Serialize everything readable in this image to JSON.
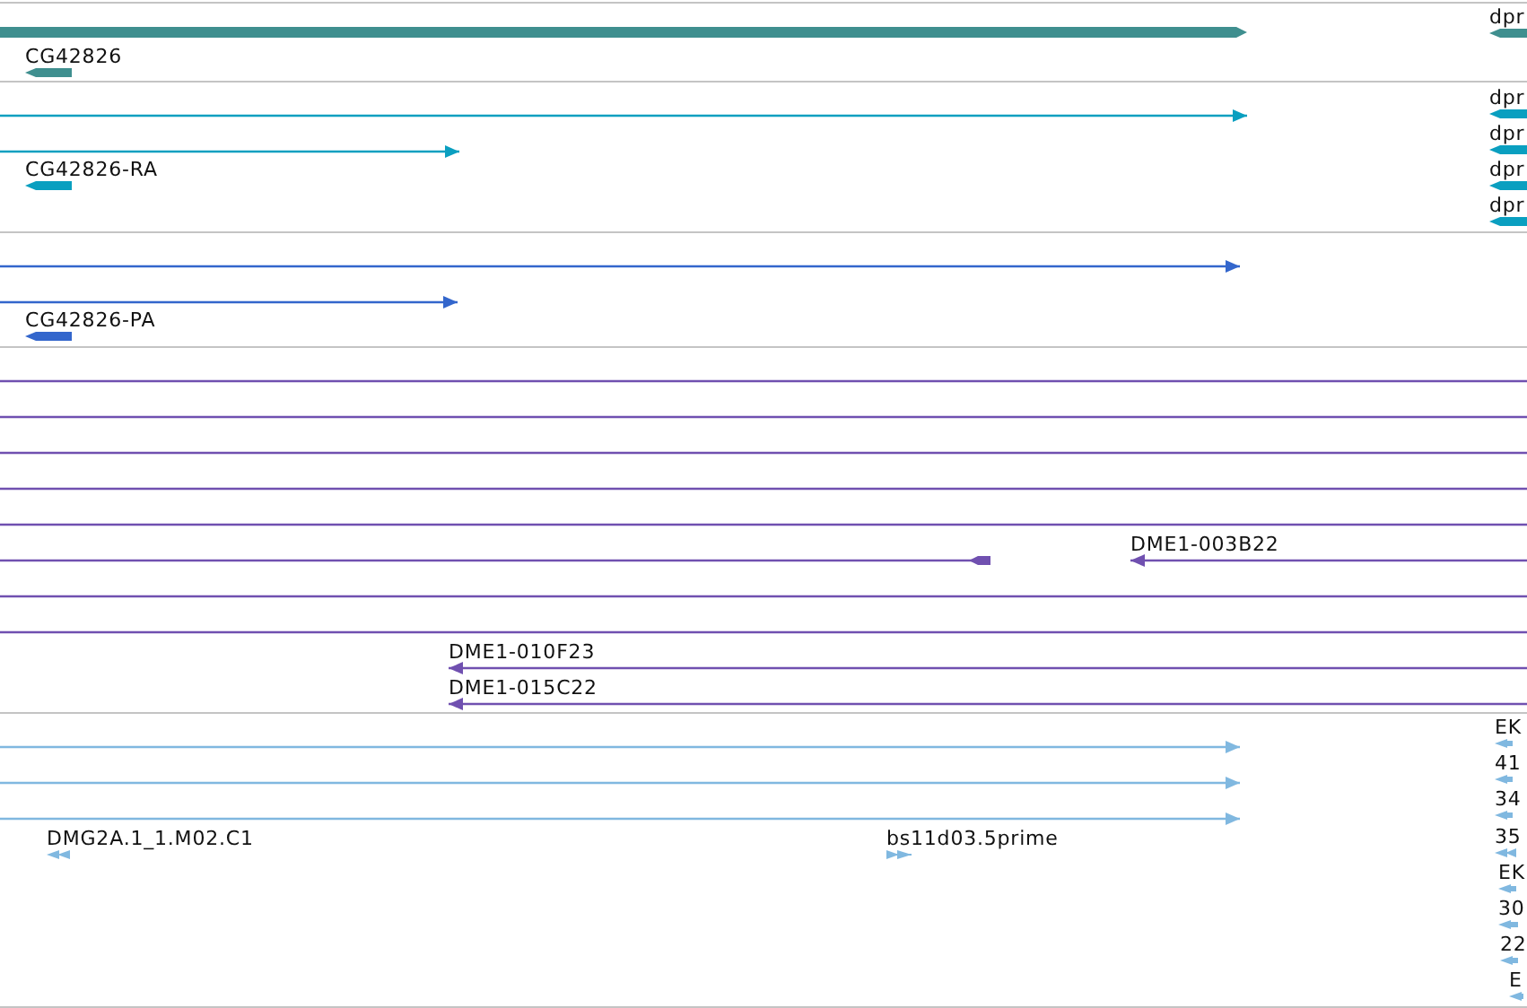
{
  "tracks": [
    {
      "color": "#3f8f8f",
      "features": [
        {
          "kind": "bar",
          "reverse": false
        },
        {
          "kind": "glyph",
          "label": "CG42826",
          "reverse": true
        },
        {
          "kind": "glyph",
          "label": "dpr",
          "reverse": true
        }
      ]
    },
    {
      "color": "#0a9fc0",
      "features": [
        {
          "kind": "line",
          "reverse": false
        },
        {
          "kind": "line",
          "reverse": false
        },
        {
          "kind": "glyph",
          "label": "CG42826-RA",
          "reverse": true
        },
        {
          "kind": "glyph",
          "label": "dpr",
          "reverse": true
        },
        {
          "kind": "glyph",
          "label": "dpr",
          "reverse": true
        },
        {
          "kind": "glyph",
          "label": "dpr",
          "reverse": true
        },
        {
          "kind": "glyph",
          "label": "dpr",
          "reverse": true
        }
      ]
    },
    {
      "color": "#3366cc",
      "features": [
        {
          "kind": "line",
          "reverse": false
        },
        {
          "kind": "line",
          "reverse": false
        },
        {
          "kind": "glyph",
          "label": "CG42826-PA",
          "reverse": true
        }
      ]
    },
    {
      "color": "#7050b0",
      "features": [
        {
          "kind": "span"
        },
        {
          "kind": "span"
        },
        {
          "kind": "span"
        },
        {
          "kind": "span"
        },
        {
          "kind": "span"
        },
        {
          "kind": "line",
          "reverse": true
        },
        {
          "kind": "line",
          "label": "DME1-003B22",
          "reverse": true
        },
        {
          "kind": "span"
        },
        {
          "kind": "span"
        },
        {
          "kind": "line",
          "label": "DME1-010F23",
          "reverse": true
        },
        {
          "kind": "line",
          "label": "DME1-015C22",
          "reverse": true
        }
      ]
    },
    {
      "color": "#80b8e0",
      "features": [
        {
          "kind": "line",
          "reverse": false
        },
        {
          "kind": "line",
          "reverse": false
        },
        {
          "kind": "line",
          "reverse": false
        },
        {
          "kind": "glyph",
          "label": "DMG2A.1_1.M02.C1",
          "reverse": true
        },
        {
          "kind": "glyph",
          "label": "bs11d03.5prime",
          "reverse": false
        },
        {
          "kind": "glyph",
          "label": "EK",
          "reverse": true
        },
        {
          "kind": "glyph",
          "label": "41",
          "reverse": true
        },
        {
          "kind": "glyph",
          "label": "34",
          "reverse": true
        },
        {
          "kind": "glyph",
          "label": "35",
          "reverse": true
        },
        {
          "kind": "glyph",
          "label": "EK",
          "reverse": true
        },
        {
          "kind": "glyph",
          "label": "30",
          "reverse": true
        },
        {
          "kind": "glyph",
          "label": "22",
          "reverse": true
        },
        {
          "kind": "glyph",
          "label": "E",
          "reverse": true
        }
      ]
    }
  ]
}
